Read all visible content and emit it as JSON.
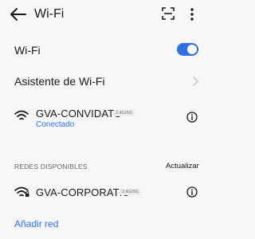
{
  "header": {
    "title": "Wi-Fi",
    "back_icon": "arrow-left-icon",
    "scan_icon": "scan-qr-icon",
    "more_icon": "more-vertical-icon"
  },
  "wifi_toggle": {
    "label": "Wi-Fi",
    "enabled": true
  },
  "assistant": {
    "label": "Asistente de Wi-Fi",
    "icon": "chevron-right-icon"
  },
  "connected_network": {
    "ssid": "GVA-CONVIDATS",
    "band": "2.4G/5G",
    "status": "Conectado",
    "signal_icon": "wifi-signal-icon",
    "info_icon": "info-icon"
  },
  "available": {
    "section_title": "REDES DISPONIBLES",
    "refresh_label": "Actualizar",
    "networks": [
      {
        "ssid": "GVA-CORPORATIU",
        "band": "2.4G/5G",
        "signal_icon": "wifi-locked-icon",
        "info_icon": "info-icon"
      }
    ]
  },
  "add_network_label": "Añadir red",
  "colors": {
    "accent": "#2f6fe8",
    "background": "#f7f7f7",
    "text": "#1a1a1a",
    "secondary_text": "#666666"
  }
}
